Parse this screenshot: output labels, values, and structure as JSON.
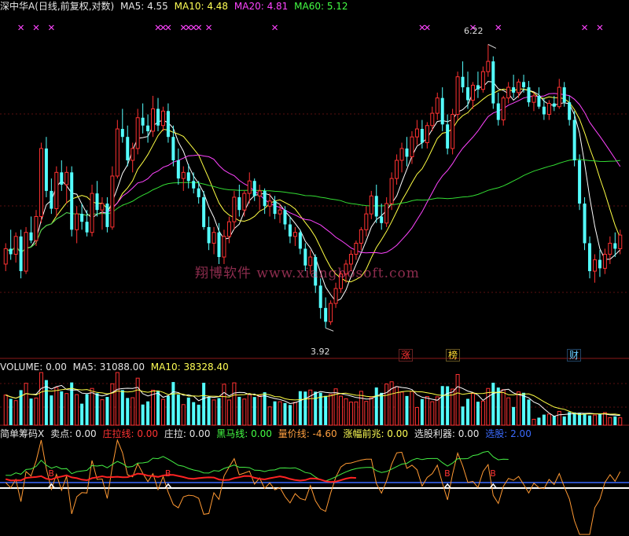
{
  "main_header": {
    "name": "深中华A(日线,前复权,对数)",
    "ma5": "MA5: 4.55",
    "ma10": "MA10: 4.48",
    "ma20": "MA20: 4.81",
    "ma60": "MA60: 5.12"
  },
  "volume_header": {
    "volume": "VOLUME: 0.00",
    "ma5": "MA5: 31088.00",
    "ma10": "MA10: 38328.40"
  },
  "indicator_header": {
    "name": "简单筹码X",
    "sell": "卖点: 0.00",
    "zhuanglaxian": "庄拉线: 0.00",
    "zhuangla": "庄拉: 0.00",
    "heima": "黑马线: 0.00",
    "liangjia": "量价线: -4.60",
    "zhangfu": "涨幅前兆: 0.00",
    "xuangu": "选股利器: 0.00",
    "xuangu2": "选股: 2.00"
  },
  "labels": {
    "high_price": "6.22",
    "low_price": "3.92",
    "tag_zhang": "涨",
    "tag_bang": "榜",
    "tag_cai": "财",
    "watermark": "翔博软件 www.xiangbosoft.com"
  },
  "chart_data": {
    "type": "candlestick",
    "price_range": [
      3.75,
      6.5
    ],
    "highest_marked": 6.22,
    "lowest_marked": 3.92,
    "last_moving_averages": {
      "MA5": 4.55,
      "MA10": 4.48,
      "MA20": 4.81,
      "MA60": 5.12
    },
    "candles": [
      [
        4.35,
        4.5,
        4.3,
        4.46
      ],
      [
        4.46,
        4.6,
        4.38,
        4.42
      ],
      [
        4.42,
        4.58,
        4.36,
        4.55
      ],
      [
        4.55,
        4.6,
        4.25,
        4.3
      ],
      [
        4.3,
        4.62,
        4.28,
        4.58
      ],
      [
        4.58,
        4.7,
        4.5,
        4.52
      ],
      [
        4.52,
        4.75,
        4.48,
        4.7
      ],
      [
        4.7,
        5.3,
        4.65,
        5.25
      ],
      [
        5.25,
        5.35,
        4.85,
        4.9
      ],
      [
        4.9,
        5.0,
        4.72,
        4.76
      ],
      [
        4.76,
        5.1,
        4.7,
        5.05
      ],
      [
        5.05,
        5.15,
        4.9,
        4.95
      ],
      [
        4.95,
        5.1,
        4.8,
        5.05
      ],
      [
        5.05,
        5.1,
        4.55,
        4.6
      ],
      [
        4.6,
        4.78,
        4.5,
        4.72
      ],
      [
        4.72,
        4.8,
        4.6,
        4.66
      ],
      [
        4.66,
        4.75,
        4.55,
        4.58
      ],
      [
        4.58,
        4.95,
        4.55,
        4.88
      ],
      [
        4.88,
        4.98,
        4.7,
        4.75
      ],
      [
        4.75,
        4.85,
        4.6,
        4.8
      ],
      [
        4.8,
        4.85,
        4.58,
        4.62
      ],
      [
        4.62,
        5.1,
        4.6,
        5.02
      ],
      [
        5.02,
        5.5,
        5.0,
        5.42
      ],
      [
        5.42,
        5.6,
        5.3,
        5.35
      ],
      [
        5.35,
        5.45,
        5.1,
        5.15
      ],
      [
        5.15,
        5.3,
        5.05,
        5.25
      ],
      [
        5.25,
        5.6,
        5.2,
        5.52
      ],
      [
        5.52,
        5.65,
        5.38,
        5.45
      ],
      [
        5.45,
        5.55,
        5.3,
        5.4
      ],
      [
        5.4,
        5.72,
        5.35,
        5.6
      ],
      [
        5.6,
        5.7,
        5.4,
        5.45
      ],
      [
        5.45,
        5.62,
        5.4,
        5.58
      ],
      [
        5.58,
        5.65,
        5.3,
        5.35
      ],
      [
        5.35,
        5.45,
        5.1,
        5.15
      ],
      [
        5.15,
        5.25,
        4.95,
        5.0
      ],
      [
        5.0,
        5.1,
        4.9,
        5.05
      ],
      [
        5.05,
        5.12,
        4.92,
        4.98
      ],
      [
        4.98,
        5.05,
        4.88,
        4.92
      ],
      [
        4.92,
        4.98,
        4.8,
        4.85
      ],
      [
        4.85,
        4.9,
        4.6,
        4.62
      ],
      [
        4.62,
        4.7,
        4.45,
        4.5
      ],
      [
        4.5,
        4.62,
        4.42,
        4.58
      ],
      [
        4.58,
        4.65,
        4.35,
        4.4
      ],
      [
        4.4,
        4.6,
        4.35,
        4.55
      ],
      [
        4.55,
        4.7,
        4.5,
        4.66
      ],
      [
        4.66,
        4.9,
        4.6,
        4.85
      ],
      [
        4.85,
        4.95,
        4.7,
        4.75
      ],
      [
        4.75,
        4.9,
        4.7,
        4.88
      ],
      [
        4.88,
        5.05,
        4.8,
        4.98
      ],
      [
        4.98,
        5.0,
        4.82,
        4.86
      ],
      [
        4.86,
        4.95,
        4.75,
        4.9
      ],
      [
        4.9,
        4.92,
        4.72,
        4.78
      ],
      [
        4.78,
        4.88,
        4.7,
        4.82
      ],
      [
        4.82,
        4.86,
        4.68,
        4.72
      ],
      [
        4.72,
        4.8,
        4.65,
        4.75
      ],
      [
        4.75,
        4.78,
        4.6,
        4.64
      ],
      [
        4.64,
        4.7,
        4.5,
        4.55
      ],
      [
        4.55,
        4.62,
        4.48,
        4.58
      ],
      [
        4.58,
        4.6,
        4.42,
        4.46
      ],
      [
        4.46,
        4.5,
        4.3,
        4.34
      ],
      [
        4.34,
        4.45,
        4.28,
        4.4
      ],
      [
        4.4,
        4.42,
        4.15,
        4.2
      ],
      [
        4.2,
        4.25,
        3.98,
        4.05
      ],
      [
        4.05,
        4.12,
        3.92,
        3.96
      ],
      [
        3.96,
        4.1,
        3.94,
        4.08
      ],
      [
        4.08,
        4.22,
        4.05,
        4.18
      ],
      [
        4.18,
        4.3,
        4.15,
        4.28
      ],
      [
        4.28,
        4.38,
        4.22,
        4.35
      ],
      [
        4.35,
        4.45,
        4.3,
        4.42
      ],
      [
        4.42,
        4.52,
        4.38,
        4.5
      ],
      [
        4.5,
        4.62,
        4.45,
        4.6
      ],
      [
        4.6,
        4.78,
        4.55,
        4.72
      ],
      [
        4.72,
        4.9,
        4.68,
        4.86
      ],
      [
        4.86,
        4.95,
        4.65,
        4.7
      ],
      [
        4.7,
        4.8,
        4.6,
        4.65
      ],
      [
        4.65,
        4.85,
        4.62,
        4.8
      ],
      [
        4.8,
        5.05,
        4.75,
        5.0
      ],
      [
        5.0,
        5.2,
        4.95,
        5.15
      ],
      [
        5.15,
        5.3,
        5.05,
        5.25
      ],
      [
        5.25,
        5.35,
        5.1,
        5.18
      ],
      [
        5.18,
        5.4,
        5.12,
        5.35
      ],
      [
        5.35,
        5.5,
        5.28,
        5.42
      ],
      [
        5.42,
        5.5,
        5.25,
        5.3
      ],
      [
        5.3,
        5.48,
        5.25,
        5.45
      ],
      [
        5.45,
        5.62,
        5.4,
        5.56
      ],
      [
        5.56,
        5.75,
        5.5,
        5.7
      ],
      [
        5.7,
        5.8,
        5.4,
        5.46
      ],
      [
        5.46,
        5.55,
        5.2,
        5.25
      ],
      [
        5.25,
        5.6,
        5.2,
        5.55
      ],
      [
        5.55,
        5.95,
        5.5,
        5.9
      ],
      [
        5.9,
        6.05,
        5.75,
        5.8
      ],
      [
        5.8,
        5.95,
        5.6,
        5.68
      ],
      [
        5.68,
        5.85,
        5.6,
        5.82
      ],
      [
        5.82,
        5.95,
        5.7,
        5.78
      ],
      [
        5.78,
        6.0,
        5.75,
        5.95
      ],
      [
        5.95,
        6.22,
        5.9,
        6.05
      ],
      [
        6.05,
        6.1,
        5.6,
        5.65
      ],
      [
        5.65,
        5.75,
        5.45,
        5.5
      ],
      [
        5.5,
        5.72,
        5.45,
        5.7
      ],
      [
        5.7,
        5.85,
        5.65,
        5.8
      ],
      [
        5.8,
        5.92,
        5.7,
        5.75
      ],
      [
        5.75,
        5.88,
        5.7,
        5.85
      ],
      [
        5.85,
        5.92,
        5.75,
        5.8
      ],
      [
        5.8,
        5.86,
        5.62,
        5.66
      ],
      [
        5.66,
        5.75,
        5.58,
        5.72
      ],
      [
        5.72,
        5.8,
        5.6,
        5.62
      ],
      [
        5.62,
        5.7,
        5.5,
        5.55
      ],
      [
        5.55,
        5.68,
        5.5,
        5.65
      ],
      [
        5.65,
        5.72,
        5.58,
        5.62
      ],
      [
        5.62,
        5.88,
        5.6,
        5.8
      ],
      [
        5.8,
        5.85,
        5.62,
        5.66
      ],
      [
        5.66,
        5.72,
        5.45,
        5.5
      ],
      [
        5.5,
        5.58,
        5.1,
        5.15
      ],
      [
        5.15,
        5.2,
        4.75,
        4.8
      ],
      [
        4.8,
        4.85,
        4.45,
        4.5
      ],
      [
        4.5,
        4.55,
        4.25,
        4.3
      ],
      [
        4.3,
        4.42,
        4.22,
        4.38
      ],
      [
        4.38,
        4.45,
        4.26,
        4.32
      ],
      [
        4.32,
        4.46,
        4.28,
        4.42
      ],
      [
        4.42,
        4.55,
        4.35,
        4.5
      ],
      [
        4.5,
        4.58,
        4.4,
        4.46
      ],
      [
        4.46,
        4.6,
        4.42,
        4.56
      ]
    ],
    "volume_ma_last": {
      "MA5": 31088.0,
      "MA10": 38328.4
    }
  }
}
